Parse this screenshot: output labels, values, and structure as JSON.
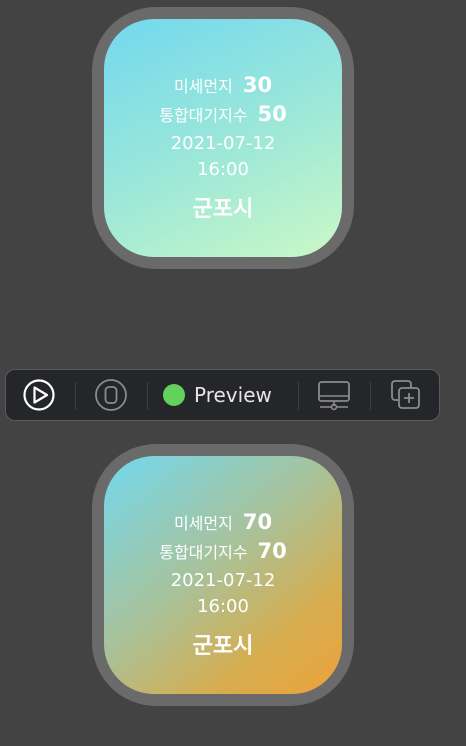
{
  "previews": [
    {
      "labels": {
        "pm10": "미세먼지",
        "aqi": "통합대기지수"
      },
      "pm10": "30",
      "aqi": "50",
      "date": "2021-07-12",
      "time": "16:00",
      "city": "군포시",
      "gradient": [
        "#72d8ee",
        "#caf8c6"
      ]
    },
    {
      "labels": {
        "pm10": "미세먼지",
        "aqi": "통합대기지수"
      },
      "pm10": "70",
      "aqi": "70",
      "date": "2021-07-12",
      "time": "16:00",
      "city": "군포시",
      "gradient": [
        "#72d8ee",
        "#eda23a"
      ]
    }
  ],
  "toolbar": {
    "preview_label": "Preview",
    "status_color": "#63d25d",
    "icons": [
      "play-circle-icon",
      "watch-device-icon",
      "status-dot-icon",
      "display-icon",
      "duplicate-icon"
    ]
  }
}
